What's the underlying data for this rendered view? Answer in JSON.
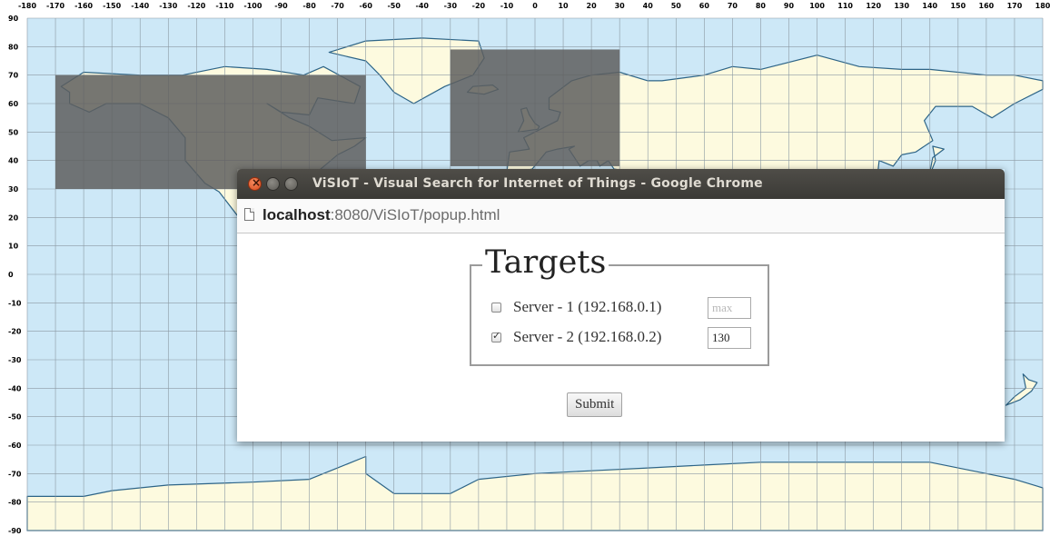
{
  "map": {
    "x_ticks": [
      "-180",
      "-170",
      "-160",
      "-150",
      "-140",
      "-130",
      "-120",
      "-110",
      "-100",
      "-90",
      "-80",
      "-70",
      "-60",
      "-50",
      "-40",
      "-30",
      "-20",
      "-10",
      "0",
      "10",
      "20",
      "30",
      "40",
      "50",
      "60",
      "70",
      "80",
      "90",
      "100",
      "110",
      "120",
      "130",
      "140",
      "150",
      "160",
      "170",
      "180"
    ],
    "y_ticks": [
      "90",
      "80",
      "70",
      "60",
      "50",
      "40",
      "30",
      "20",
      "10",
      "0",
      "-10",
      "-20",
      "-30",
      "-40",
      "-50",
      "-60",
      "-70",
      "-80",
      "-90"
    ],
    "selected_regions": [
      {
        "lon": [
          -170,
          -60
        ],
        "lat": [
          30,
          70
        ]
      },
      {
        "lon": [
          -30,
          30
        ],
        "lat": [
          38,
          79
        ]
      }
    ],
    "colors": {
      "ocean": "#cde8f7",
      "land": "#fdfadf",
      "grid": "#8b99a3",
      "coast": "#2d6487",
      "selection": "#5e5e5e"
    }
  },
  "window": {
    "title": "ViSIoT - Visual Search for Internet of Things - Google Chrome",
    "url_host": "localhost",
    "url_path": ":8080/ViSIoT/popup.html"
  },
  "form": {
    "legend": "Targets",
    "servers": [
      {
        "label": "Server - 1 (192.168.0.1)",
        "checked": false,
        "value": "",
        "placeholder": "max"
      },
      {
        "label": "Server - 2 (192.168.0.2)",
        "checked": true,
        "value": "130",
        "placeholder": ""
      }
    ],
    "submit_label": "Submit"
  }
}
